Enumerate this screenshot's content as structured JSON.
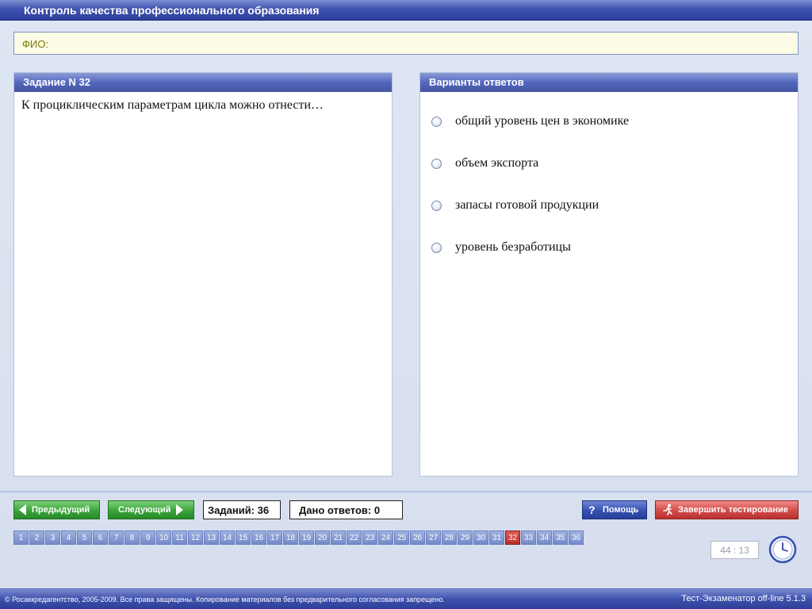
{
  "window": {
    "title": "Контроль качества профессионального образования"
  },
  "fio": {
    "label": "ФИО:"
  },
  "question_panel": {
    "header": "Задание N 32",
    "text": "К проциклическим параметрам цикла можно отнести…"
  },
  "answers_panel": {
    "header": "Варианты ответов",
    "options": [
      "общий уровень цен в экономике",
      "объем экспорта",
      "запасы готовой продукции",
      "уровень безработицы"
    ]
  },
  "toolbar": {
    "prev_label": "Предыдущий",
    "next_label": "Следующий",
    "tasks_count": "Заданий: 36",
    "answers_given": "Дано ответов: 0",
    "help_label": "Помощь",
    "finish_label": "Завершить тестирование"
  },
  "question_nav": {
    "numbers": [
      "1",
      "2",
      "3",
      "4",
      "5",
      "6",
      "7",
      "8",
      "9",
      "10",
      "11",
      "12",
      "13",
      "14",
      "15",
      "16",
      "17",
      "18",
      "19",
      "20",
      "21",
      "22",
      "23",
      "24",
      "25",
      "26",
      "27",
      "28",
      "29",
      "30",
      "31",
      "32",
      "33",
      "34",
      "35",
      "36"
    ],
    "current": "32"
  },
  "timer": {
    "value": "44 : 13"
  },
  "statusbar": {
    "copyright": "© Росаккредагентство, 2005-2009. Все права защищены. Копирование материалов без предварительного согласования запрещено.",
    "version": "Тест-Экзаменатор off-line 5.1.3"
  },
  "icons": {
    "prev": "triangle-left-icon",
    "next": "triangle-right-icon",
    "help": "question-mark-icon",
    "finish": "running-man-icon",
    "timer": "clock-icon"
  },
  "colors": {
    "title_bar": "#3f53b0",
    "panel_header": "#5467bf",
    "nav_button": "#3ba43a",
    "help_button": "#3650b3",
    "finish_button": "#d34b48",
    "current_question": "#b82d28",
    "question_number": "#7489c8",
    "fio_background": "#fbfbe6"
  }
}
